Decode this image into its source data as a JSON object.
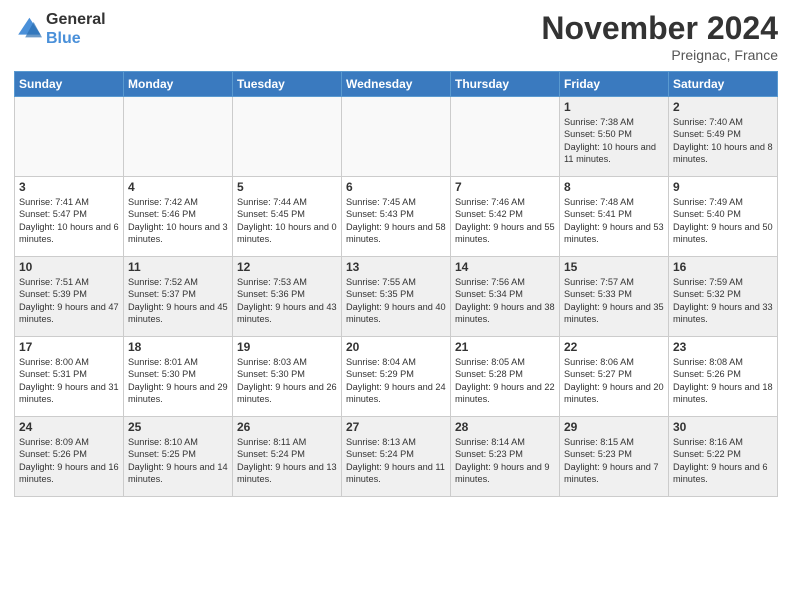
{
  "header": {
    "logo_line1": "General",
    "logo_line2": "Blue",
    "month": "November 2024",
    "location": "Preignac, France"
  },
  "weekdays": [
    "Sunday",
    "Monday",
    "Tuesday",
    "Wednesday",
    "Thursday",
    "Friday",
    "Saturday"
  ],
  "weeks": [
    [
      {
        "day": "",
        "info": ""
      },
      {
        "day": "",
        "info": ""
      },
      {
        "day": "",
        "info": ""
      },
      {
        "day": "",
        "info": ""
      },
      {
        "day": "",
        "info": ""
      },
      {
        "day": "1",
        "info": "Sunrise: 7:38 AM\nSunset: 5:50 PM\nDaylight: 10 hours and 11 minutes."
      },
      {
        "day": "2",
        "info": "Sunrise: 7:40 AM\nSunset: 5:49 PM\nDaylight: 10 hours and 8 minutes."
      }
    ],
    [
      {
        "day": "3",
        "info": "Sunrise: 7:41 AM\nSunset: 5:47 PM\nDaylight: 10 hours and 6 minutes."
      },
      {
        "day": "4",
        "info": "Sunrise: 7:42 AM\nSunset: 5:46 PM\nDaylight: 10 hours and 3 minutes."
      },
      {
        "day": "5",
        "info": "Sunrise: 7:44 AM\nSunset: 5:45 PM\nDaylight: 10 hours and 0 minutes."
      },
      {
        "day": "6",
        "info": "Sunrise: 7:45 AM\nSunset: 5:43 PM\nDaylight: 9 hours and 58 minutes."
      },
      {
        "day": "7",
        "info": "Sunrise: 7:46 AM\nSunset: 5:42 PM\nDaylight: 9 hours and 55 minutes."
      },
      {
        "day": "8",
        "info": "Sunrise: 7:48 AM\nSunset: 5:41 PM\nDaylight: 9 hours and 53 minutes."
      },
      {
        "day": "9",
        "info": "Sunrise: 7:49 AM\nSunset: 5:40 PM\nDaylight: 9 hours and 50 minutes."
      }
    ],
    [
      {
        "day": "10",
        "info": "Sunrise: 7:51 AM\nSunset: 5:39 PM\nDaylight: 9 hours and 47 minutes."
      },
      {
        "day": "11",
        "info": "Sunrise: 7:52 AM\nSunset: 5:37 PM\nDaylight: 9 hours and 45 minutes."
      },
      {
        "day": "12",
        "info": "Sunrise: 7:53 AM\nSunset: 5:36 PM\nDaylight: 9 hours and 43 minutes."
      },
      {
        "day": "13",
        "info": "Sunrise: 7:55 AM\nSunset: 5:35 PM\nDaylight: 9 hours and 40 minutes."
      },
      {
        "day": "14",
        "info": "Sunrise: 7:56 AM\nSunset: 5:34 PM\nDaylight: 9 hours and 38 minutes."
      },
      {
        "day": "15",
        "info": "Sunrise: 7:57 AM\nSunset: 5:33 PM\nDaylight: 9 hours and 35 minutes."
      },
      {
        "day": "16",
        "info": "Sunrise: 7:59 AM\nSunset: 5:32 PM\nDaylight: 9 hours and 33 minutes."
      }
    ],
    [
      {
        "day": "17",
        "info": "Sunrise: 8:00 AM\nSunset: 5:31 PM\nDaylight: 9 hours and 31 minutes."
      },
      {
        "day": "18",
        "info": "Sunrise: 8:01 AM\nSunset: 5:30 PM\nDaylight: 9 hours and 29 minutes."
      },
      {
        "day": "19",
        "info": "Sunrise: 8:03 AM\nSunset: 5:30 PM\nDaylight: 9 hours and 26 minutes."
      },
      {
        "day": "20",
        "info": "Sunrise: 8:04 AM\nSunset: 5:29 PM\nDaylight: 9 hours and 24 minutes."
      },
      {
        "day": "21",
        "info": "Sunrise: 8:05 AM\nSunset: 5:28 PM\nDaylight: 9 hours and 22 minutes."
      },
      {
        "day": "22",
        "info": "Sunrise: 8:06 AM\nSunset: 5:27 PM\nDaylight: 9 hours and 20 minutes."
      },
      {
        "day": "23",
        "info": "Sunrise: 8:08 AM\nSunset: 5:26 PM\nDaylight: 9 hours and 18 minutes."
      }
    ],
    [
      {
        "day": "24",
        "info": "Sunrise: 8:09 AM\nSunset: 5:26 PM\nDaylight: 9 hours and 16 minutes."
      },
      {
        "day": "25",
        "info": "Sunrise: 8:10 AM\nSunset: 5:25 PM\nDaylight: 9 hours and 14 minutes."
      },
      {
        "day": "26",
        "info": "Sunrise: 8:11 AM\nSunset: 5:24 PM\nDaylight: 9 hours and 13 minutes."
      },
      {
        "day": "27",
        "info": "Sunrise: 8:13 AM\nSunset: 5:24 PM\nDaylight: 9 hours and 11 minutes."
      },
      {
        "day": "28",
        "info": "Sunrise: 8:14 AM\nSunset: 5:23 PM\nDaylight: 9 hours and 9 minutes."
      },
      {
        "day": "29",
        "info": "Sunrise: 8:15 AM\nSunset: 5:23 PM\nDaylight: 9 hours and 7 minutes."
      },
      {
        "day": "30",
        "info": "Sunrise: 8:16 AM\nSunset: 5:22 PM\nDaylight: 9 hours and 6 minutes."
      }
    ]
  ]
}
